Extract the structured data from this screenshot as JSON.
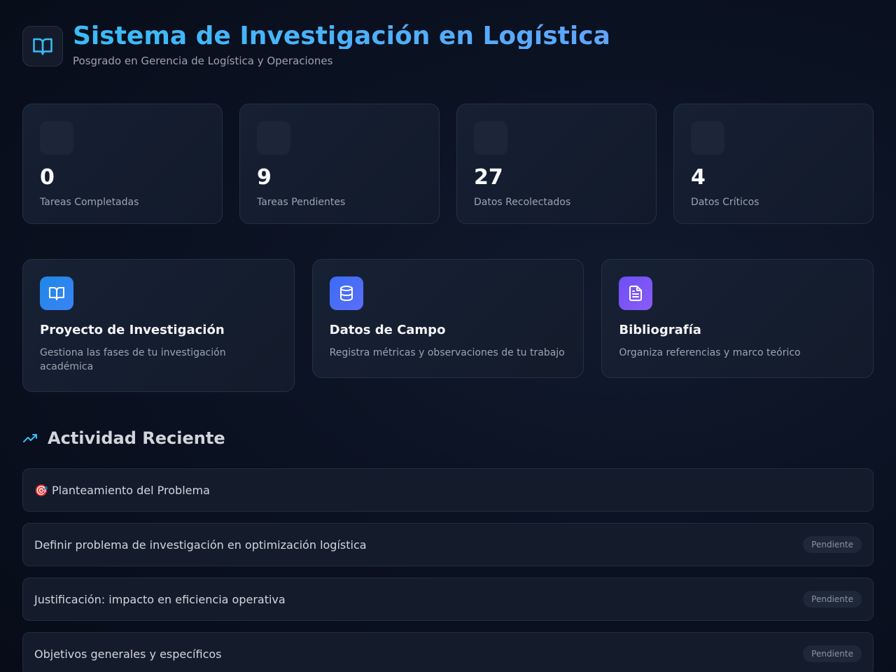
{
  "header": {
    "icon": "book-open-icon",
    "title": "Sistema de Investigación en Logística",
    "subtitle": "Posgrado en Gerencia de Logística y Operaciones"
  },
  "stats": [
    {
      "value": "0",
      "label": "Tareas Completadas"
    },
    {
      "value": "9",
      "label": "Tareas Pendientes"
    },
    {
      "value": "27",
      "label": "Datos Recolectados"
    },
    {
      "value": "4",
      "label": "Datos Críticos"
    }
  ],
  "modules": [
    {
      "icon": "book-open-icon",
      "title": "Proyecto de Investigación",
      "description": "Gestiona las fases de tu investigación académica",
      "color": "#2196f3"
    },
    {
      "icon": "database-icon",
      "title": "Datos de Campo",
      "description": "Registra métricas y observaciones de tu trabajo",
      "color": "#4f6ef7"
    },
    {
      "icon": "file-text-icon",
      "title": "Bibliografía",
      "description": "Organiza referencias y marco teórico",
      "color": "#7c4dff"
    }
  ],
  "activity": {
    "icon": "trending-up-icon",
    "title": "Actividad Reciente",
    "items": [
      {
        "text": "🎯 Planteamiento del Problema",
        "status": ""
      },
      {
        "text": "Definir problema de investigación en optimización logística",
        "status": "Pendiente"
      },
      {
        "text": "Justificación: impacto en eficiencia operativa",
        "status": "Pendiente"
      },
      {
        "text": "Objetivos generales y específicos",
        "status": "Pendiente"
      }
    ]
  }
}
